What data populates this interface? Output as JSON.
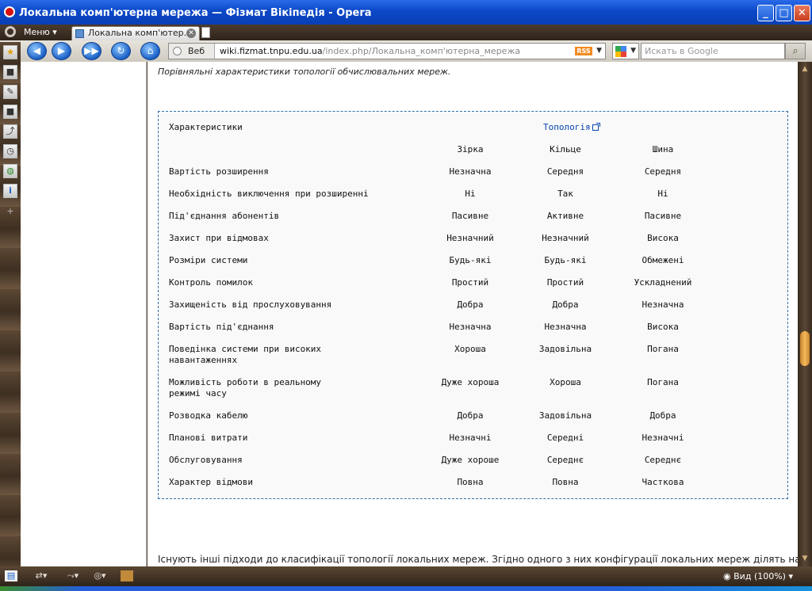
{
  "window": {
    "title": "Локальна комп'ютерна мережа — Фізмат Вікіпедія - Opera",
    "minimize": "_",
    "maximize": "□",
    "close": "✕"
  },
  "tabs": {
    "menu_label": "Меню",
    "items": [
      {
        "label": "Локальна комп'ютер..."
      }
    ]
  },
  "address_bar": {
    "kind": "Веб",
    "url_domain": "wiki.fizmat.tnpu.edu.ua",
    "url_path": "/index.php/Локальна_комп'ютерна_мережа",
    "rss": "RSS"
  },
  "search": {
    "placeholder": "Искать в Google"
  },
  "content": {
    "caption": "Порівняльні характеристики топології обчислювальних мереж.",
    "table": {
      "header_label": "Характеристики",
      "header_topology": "Топологія",
      "columns": [
        "Зірка",
        "Кільце",
        "Шина"
      ],
      "rows": [
        {
          "label": "Вартість розширення",
          "values": [
            "Незначна",
            "Середня",
            "Середня"
          ]
        },
        {
          "label": "Необхідність виключення при розширенні",
          "values": [
            "Ні",
            "Так",
            "Ні"
          ]
        },
        {
          "label": "Під'єднання абонентів",
          "values": [
            "Пасивне",
            "Активне",
            "Пасивне"
          ]
        },
        {
          "label": "Захист при відмовах",
          "values": [
            "Незначний",
            "Незначний",
            "Висока"
          ]
        },
        {
          "label": "Розміри системи",
          "values": [
            "Будь-які",
            "Будь-які",
            "Обмежені"
          ]
        },
        {
          "label": "Контроль помилок",
          "values": [
            "Простий",
            "Простий",
            "Ускладнений"
          ]
        },
        {
          "label": "Захищеність від прослуховування",
          "values": [
            "Добра",
            "Добра",
            "Незначна"
          ]
        },
        {
          "label": "Вартість під'єднання",
          "values": [
            "Незначна",
            "Незначна",
            "Висока"
          ]
        },
        {
          "label": "Поведінка системи при високих\nнавантаженнях",
          "values": [
            "Хороша",
            "Задовільна",
            "Погана"
          ]
        },
        {
          "label": "Можливість роботи в реальному\nрежимі часу",
          "values": [
            "Дуже хороша",
            "Хороша",
            "Погана"
          ]
        },
        {
          "label": "Розводка кабелю",
          "values": [
            "Добра",
            "Задовільна",
            "Добра"
          ]
        },
        {
          "label": "Планові витрати",
          "values": [
            "Незначні",
            "Середні",
            "Незначні"
          ]
        },
        {
          "label": "Обслуговування",
          "values": [
            "Дуже хороше",
            "Середнє",
            "Середнє"
          ]
        },
        {
          "label": "Характер відмови",
          "values": [
            "Повна",
            "Повна",
            "Часткова"
          ]
        }
      ]
    },
    "bottom_text": "Існують інші підходи до класифікації топології локальних мереж. Згідно одного з них конфігурації локальних мереж ділять на два"
  },
  "status": {
    "zoom": "Вид (100%)"
  },
  "icons": {
    "back": "◀",
    "forward": "▶",
    "fast_forward": "▶▶",
    "reload": "↻",
    "home": "⌂",
    "search_go": "⌕",
    "star": "★",
    "notes": "✎",
    "save": "■",
    "share": "⤴",
    "history": "◷",
    "globe": "◍",
    "info": "i",
    "add": "+",
    "scroll_up": "▲",
    "scroll_down": "▼"
  },
  "colors": {
    "accent": "#0645ad",
    "table_border": "#2f6fab",
    "titlebar": "#0b48c8"
  }
}
